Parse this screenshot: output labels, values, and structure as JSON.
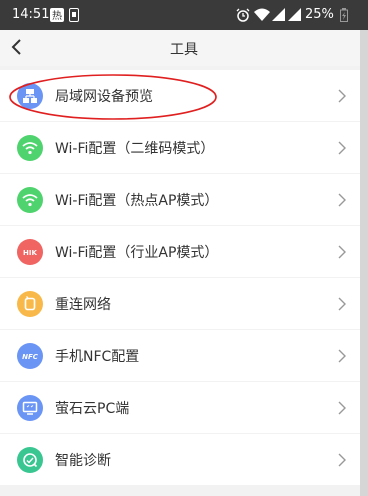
{
  "status_bar": {
    "time": "14:51",
    "battery_text": "25%",
    "icons": [
      "hot-app-icon",
      "sim-icon",
      "alarm-icon",
      "wifi-icon",
      "signal-icon",
      "signal-icon",
      "battery-icon"
    ]
  },
  "header": {
    "title": "工具",
    "back_icon": "chevron-left-icon"
  },
  "items": [
    {
      "label": "局域网设备预览",
      "icon": "lan-device-icon",
      "color": "#6b95f5"
    },
    {
      "label": "Wi-Fi配置（二维码模式）",
      "icon": "wifi-icon",
      "color": "#4fd36e"
    },
    {
      "label": "Wi-Fi配置（热点AP模式）",
      "icon": "wifi-icon",
      "color": "#4fd36e"
    },
    {
      "label": "Wi-Fi配置（行业AP模式）",
      "icon": "hik-icon",
      "icon_text": "HIK",
      "color": "#f06461"
    },
    {
      "label": "重连网络",
      "icon": "reconnect-icon",
      "color": "#f9b94a"
    },
    {
      "label": "手机NFC配置",
      "icon": "nfc-icon",
      "icon_text": "NFC",
      "color": "#6b95f5"
    },
    {
      "label": "萤石云PC端",
      "icon": "pc-monitor-icon",
      "color": "#6b95f5"
    },
    {
      "label": "智能诊断",
      "icon": "diagnose-icon",
      "color": "#3ac691"
    }
  ],
  "annotation_color": "#e02020"
}
